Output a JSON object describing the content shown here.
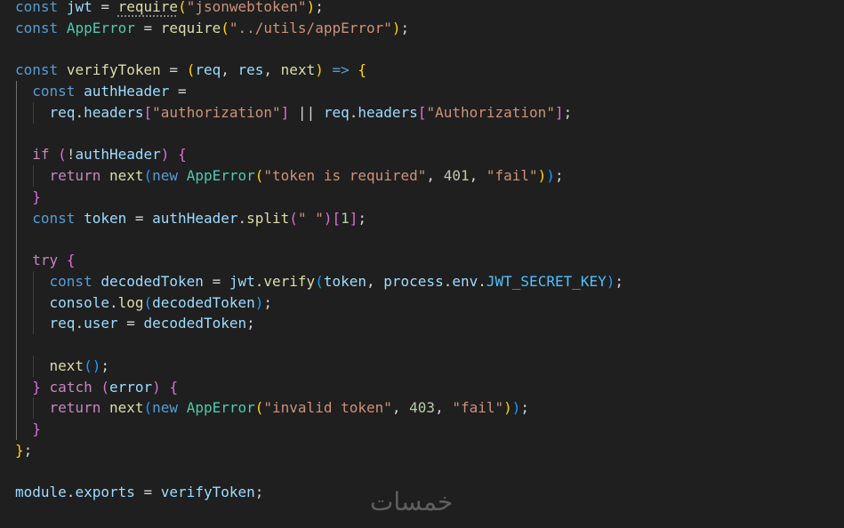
{
  "editor": {
    "language": "javascript",
    "theme": "dark",
    "lines": [
      [
        [
          "kw",
          "const"
        ],
        [
          "pn",
          " "
        ],
        [
          "var",
          "jwt"
        ],
        [
          "pn",
          " = "
        ],
        [
          "fn dots",
          "require"
        ],
        [
          "b1",
          "("
        ],
        [
          "str",
          "\"jsonwebtoken\""
        ],
        [
          "b1",
          ")"
        ],
        [
          "pn",
          ";"
        ]
      ],
      [
        [
          "kw",
          "const"
        ],
        [
          "pn",
          " "
        ],
        [
          "cls",
          "AppError"
        ],
        [
          "pn",
          " = "
        ],
        [
          "fn",
          "require"
        ],
        [
          "b1",
          "("
        ],
        [
          "str",
          "\"../utils/appError\""
        ],
        [
          "b1",
          ")"
        ],
        [
          "pn",
          ";"
        ]
      ],
      [],
      [
        [
          "kw",
          "const"
        ],
        [
          "pn",
          " "
        ],
        [
          "fn",
          "verifyToken"
        ],
        [
          "pn",
          " = "
        ],
        [
          "b1",
          "("
        ],
        [
          "var",
          "req"
        ],
        [
          "pn",
          ", "
        ],
        [
          "var",
          "res"
        ],
        [
          "pn",
          ", "
        ],
        [
          "fn",
          "next"
        ],
        [
          "b1",
          ")"
        ],
        [
          "pn",
          " "
        ],
        [
          "kw",
          "=>"
        ],
        [
          "pn",
          " "
        ],
        [
          "b1",
          "{"
        ]
      ],
      [
        [
          "pn",
          "  "
        ],
        [
          "kw",
          "const"
        ],
        [
          "pn",
          " "
        ],
        [
          "var",
          "authHeader"
        ],
        [
          "pn",
          " ="
        ]
      ],
      [
        [
          "pn",
          "    "
        ],
        [
          "var",
          "req"
        ],
        [
          "pn",
          "."
        ],
        [
          "var",
          "headers"
        ],
        [
          "b2",
          "["
        ],
        [
          "str",
          "\"authorization\""
        ],
        [
          "b2",
          "]"
        ],
        [
          "pn",
          " || "
        ],
        [
          "var",
          "req"
        ],
        [
          "pn",
          "."
        ],
        [
          "var",
          "headers"
        ],
        [
          "b2",
          "["
        ],
        [
          "str",
          "\"Authorization\""
        ],
        [
          "b2",
          "]"
        ],
        [
          "pn",
          ";"
        ]
      ],
      [],
      [
        [
          "pn",
          "  "
        ],
        [
          "ctl",
          "if"
        ],
        [
          "pn",
          " "
        ],
        [
          "b2",
          "("
        ],
        [
          "pn",
          "!"
        ],
        [
          "var",
          "authHeader"
        ],
        [
          "b2",
          ")"
        ],
        [
          "pn",
          " "
        ],
        [
          "b2",
          "{"
        ]
      ],
      [
        [
          "pn",
          "    "
        ],
        [
          "ctl",
          "return"
        ],
        [
          "pn",
          " "
        ],
        [
          "fn",
          "next"
        ],
        [
          "b3",
          "("
        ],
        [
          "kw",
          "new"
        ],
        [
          "pn",
          " "
        ],
        [
          "cls",
          "AppError"
        ],
        [
          "b1",
          "("
        ],
        [
          "str",
          "\"token is required\""
        ],
        [
          "pn",
          ", "
        ],
        [
          "num",
          "401"
        ],
        [
          "pn",
          ", "
        ],
        [
          "str",
          "\"fail\""
        ],
        [
          "b1",
          ")"
        ],
        [
          "b3",
          ")"
        ],
        [
          "pn",
          ";"
        ]
      ],
      [
        [
          "pn",
          "  "
        ],
        [
          "b2",
          "}"
        ]
      ],
      [
        [
          "pn",
          "  "
        ],
        [
          "kw",
          "const"
        ],
        [
          "pn",
          " "
        ],
        [
          "var",
          "token"
        ],
        [
          "pn",
          " = "
        ],
        [
          "var",
          "authHeader"
        ],
        [
          "pn",
          "."
        ],
        [
          "fn",
          "split"
        ],
        [
          "b2",
          "("
        ],
        [
          "str",
          "\" \""
        ],
        [
          "b2",
          ")"
        ],
        [
          "b2",
          "["
        ],
        [
          "num",
          "1"
        ],
        [
          "b2",
          "]"
        ],
        [
          "pn",
          ";"
        ]
      ],
      [],
      [
        [
          "pn",
          "  "
        ],
        [
          "ctl",
          "try"
        ],
        [
          "pn",
          " "
        ],
        [
          "b2",
          "{"
        ]
      ],
      [
        [
          "pn",
          "    "
        ],
        [
          "kw",
          "const"
        ],
        [
          "pn",
          " "
        ],
        [
          "var",
          "decodedToken"
        ],
        [
          "pn",
          " = "
        ],
        [
          "var",
          "jwt"
        ],
        [
          "pn",
          "."
        ],
        [
          "fn",
          "verify"
        ],
        [
          "b3",
          "("
        ],
        [
          "var",
          "token"
        ],
        [
          "pn",
          ", "
        ],
        [
          "var",
          "process"
        ],
        [
          "pn",
          "."
        ],
        [
          "var",
          "env"
        ],
        [
          "pn",
          "."
        ],
        [
          "con",
          "JWT_SECRET_KEY"
        ],
        [
          "b3",
          ")"
        ],
        [
          "pn",
          ";"
        ]
      ],
      [
        [
          "pn",
          "    "
        ],
        [
          "var",
          "console"
        ],
        [
          "pn",
          "."
        ],
        [
          "fn",
          "log"
        ],
        [
          "b3",
          "("
        ],
        [
          "var",
          "decodedToken"
        ],
        [
          "b3",
          ")"
        ],
        [
          "pn",
          ";"
        ]
      ],
      [
        [
          "pn",
          "    "
        ],
        [
          "var",
          "req"
        ],
        [
          "pn",
          "."
        ],
        [
          "var",
          "user"
        ],
        [
          "pn",
          " = "
        ],
        [
          "var",
          "decodedToken"
        ],
        [
          "pn",
          ";"
        ]
      ],
      [],
      [
        [
          "pn",
          "    "
        ],
        [
          "fn",
          "next"
        ],
        [
          "b3",
          "("
        ],
        [
          "b3",
          ")"
        ],
        [
          "pn",
          ";"
        ]
      ],
      [
        [
          "pn",
          "  "
        ],
        [
          "b2",
          "}"
        ],
        [
          "pn",
          " "
        ],
        [
          "ctl",
          "catch"
        ],
        [
          "pn",
          " "
        ],
        [
          "b2",
          "("
        ],
        [
          "var",
          "error"
        ],
        [
          "b2",
          ")"
        ],
        [
          "pn",
          " "
        ],
        [
          "b2",
          "{"
        ]
      ],
      [
        [
          "pn",
          "    "
        ],
        [
          "ctl",
          "return"
        ],
        [
          "pn",
          " "
        ],
        [
          "fn",
          "next"
        ],
        [
          "b3",
          "("
        ],
        [
          "kw",
          "new"
        ],
        [
          "pn",
          " "
        ],
        [
          "cls",
          "AppError"
        ],
        [
          "b1",
          "("
        ],
        [
          "str",
          "\"invalid token\""
        ],
        [
          "pn",
          ", "
        ],
        [
          "num",
          "403"
        ],
        [
          "pn",
          ", "
        ],
        [
          "str",
          "\"fail\""
        ],
        [
          "b1",
          ")"
        ],
        [
          "b3",
          ")"
        ],
        [
          "pn",
          ";"
        ]
      ],
      [
        [
          "pn",
          "  "
        ],
        [
          "b2",
          "}"
        ]
      ],
      [
        [
          "b1",
          "}"
        ],
        [
          "pn",
          ";"
        ]
      ],
      [],
      [
        [
          "var",
          "module"
        ],
        [
          "pn",
          "."
        ],
        [
          "var",
          "exports"
        ],
        [
          "pn",
          " = "
        ],
        [
          "var",
          "verifyToken"
        ],
        [
          "pn",
          ";"
        ]
      ]
    ]
  },
  "watermark": {
    "text": "خمسات"
  }
}
